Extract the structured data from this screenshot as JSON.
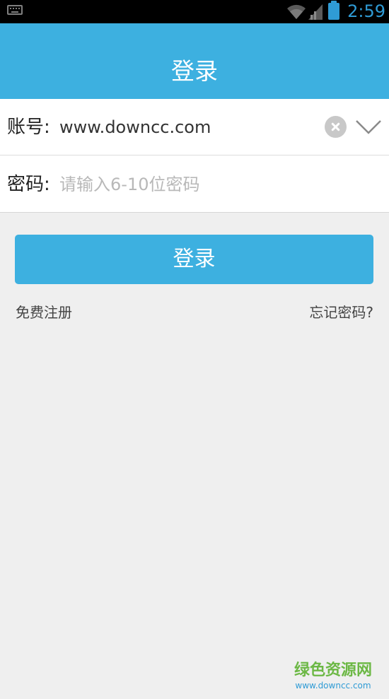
{
  "status_bar": {
    "time": "2:59",
    "icons": [
      "keyboard-icon",
      "wifi-icon",
      "signal-icon",
      "battery-icon"
    ],
    "accent_color": "#2f9bd5"
  },
  "header": {
    "title": "登录",
    "background_color": "#3db0e0"
  },
  "form": {
    "account": {
      "label": "账号:",
      "value": "www.downcc.com",
      "icons": [
        "clear-icon",
        "chevron-down-icon"
      ]
    },
    "password": {
      "label": "密码:",
      "placeholder": "请输入6-10位密码"
    }
  },
  "actions": {
    "login_label": "登录",
    "register_label": "免费注册",
    "forgot_label": "忘记密码?"
  },
  "watermark": {
    "title": "绿色资源网",
    "url": "www.downcc.com"
  }
}
